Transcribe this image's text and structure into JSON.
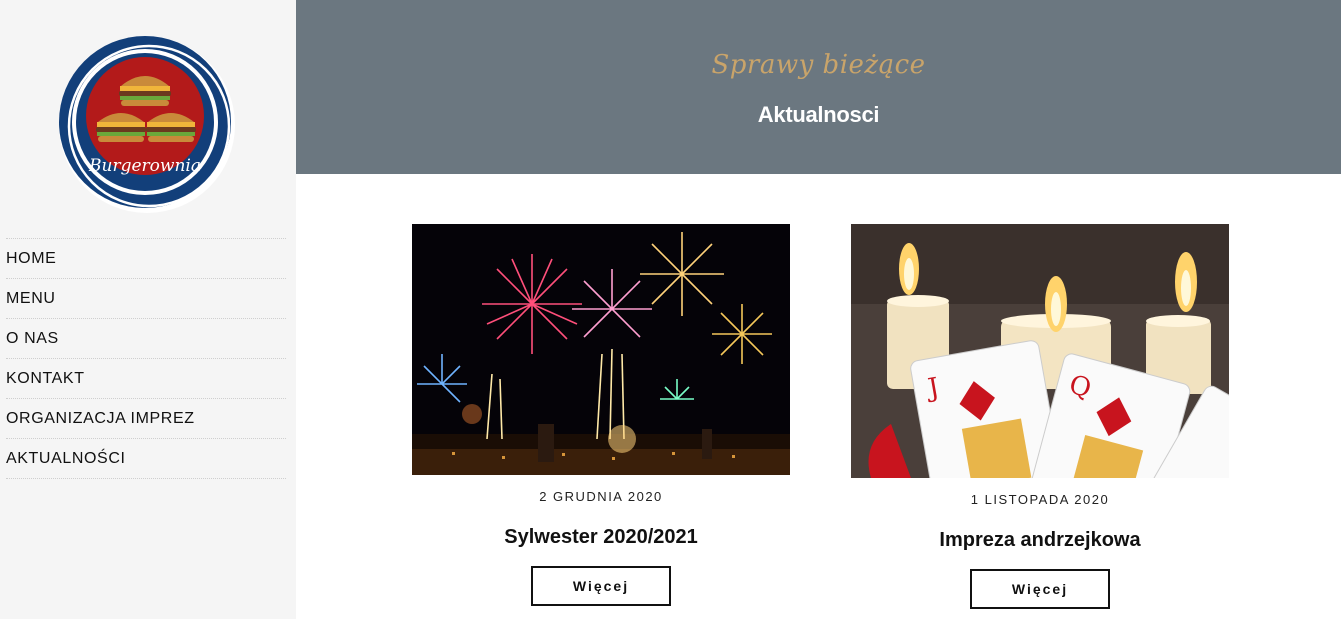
{
  "brand": {
    "logo_text": "Burgerownia",
    "colors": {
      "ring": "#123f7a",
      "inner": "#b31a1a",
      "gold": "#c9a46a"
    }
  },
  "nav": {
    "items": [
      {
        "label": "HOME"
      },
      {
        "label": "MENU"
      },
      {
        "label": "O NAS"
      },
      {
        "label": "KONTAKT"
      },
      {
        "label": "ORGANIZACJA IMPREZ"
      },
      {
        "label": "AKTUALNOŚCI"
      }
    ]
  },
  "header": {
    "subtitle": "Sprawy bieżące",
    "title": "Aktualnosci",
    "background": "#6b7780"
  },
  "posts": [
    {
      "image": "fireworks-photo",
      "date": "2 GRUDNIA 2020",
      "title": "Sylwester 2020/2021",
      "button": "Więcej"
    },
    {
      "image": "candles-and-playing-cards-photo",
      "date": "1 LISTOPADA 2020",
      "title": "Impreza andrzejkowa",
      "button": "Więcej"
    }
  ]
}
